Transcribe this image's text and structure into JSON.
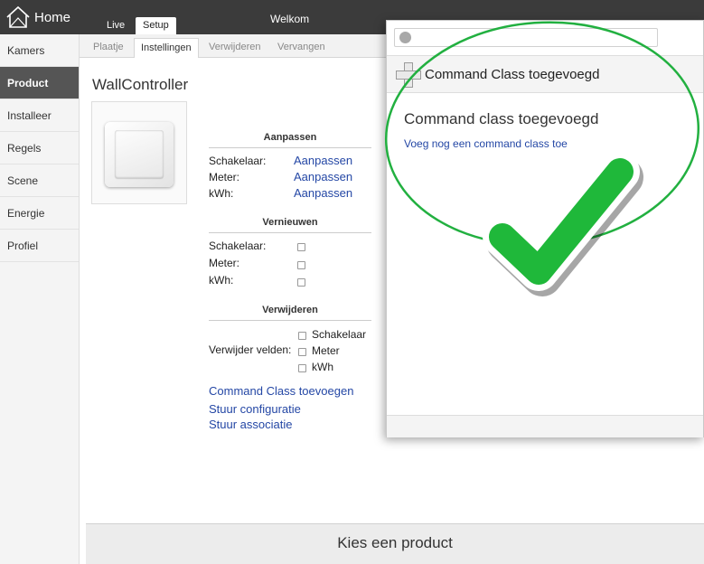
{
  "topbar": {
    "home_label": "Home",
    "tabs": [
      {
        "label": "Live"
      },
      {
        "label": "Setup"
      }
    ],
    "welcome": "Welkom"
  },
  "sidebar": {
    "items": [
      {
        "label": "Kamers"
      },
      {
        "label": "Product",
        "active": true
      },
      {
        "label": "Installeer"
      },
      {
        "label": "Regels"
      },
      {
        "label": "Scene"
      },
      {
        "label": "Energie"
      },
      {
        "label": "Profiel"
      }
    ]
  },
  "subtabs": [
    {
      "label": "Plaatje"
    },
    {
      "label": "Instellingen",
      "active": true
    },
    {
      "label": "Verwijderen"
    },
    {
      "label": "Vervangen"
    }
  ],
  "product": {
    "title": "WallController"
  },
  "aanpassen": {
    "heading": "Aanpassen",
    "rows": [
      {
        "label": "Schakelaar:",
        "link": "Aanpassen"
      },
      {
        "label": "Meter:",
        "link": "Aanpassen"
      },
      {
        "label": "kWh:",
        "link": "Aanpassen"
      }
    ]
  },
  "vernieuwen": {
    "heading": "Vernieuwen",
    "rows": [
      {
        "label": "Schakelaar:"
      },
      {
        "label": "Meter:"
      },
      {
        "label": "kWh:"
      }
    ]
  },
  "verwijderen": {
    "heading": "Verwijderen",
    "field_label": "Verwijder velden:",
    "options": [
      {
        "label": "Schakelaar"
      },
      {
        "label": "Meter"
      },
      {
        "label": "kWh"
      }
    ]
  },
  "actions": [
    {
      "label": "Command Class toevoegen"
    },
    {
      "label": "Stuur configuratie"
    },
    {
      "label": "Stuur associatie"
    }
  ],
  "bottom_bar": {
    "label": "Kies een product"
  },
  "modal": {
    "url_value": "",
    "header_title": "Command Class toegevoegd",
    "heading": "Command class toegevoegd",
    "link": "Voeg nog een command class toe"
  },
  "colors": {
    "topbar": "#3b3b3b",
    "link": "#2447a5",
    "highlight_ring": "#22b040",
    "checkmark": "#1fb83a"
  },
  "icons": {
    "home": "home-icon",
    "globe": "globe-icon",
    "plus": "plus-icon",
    "checkmark": "checkmark-icon"
  }
}
